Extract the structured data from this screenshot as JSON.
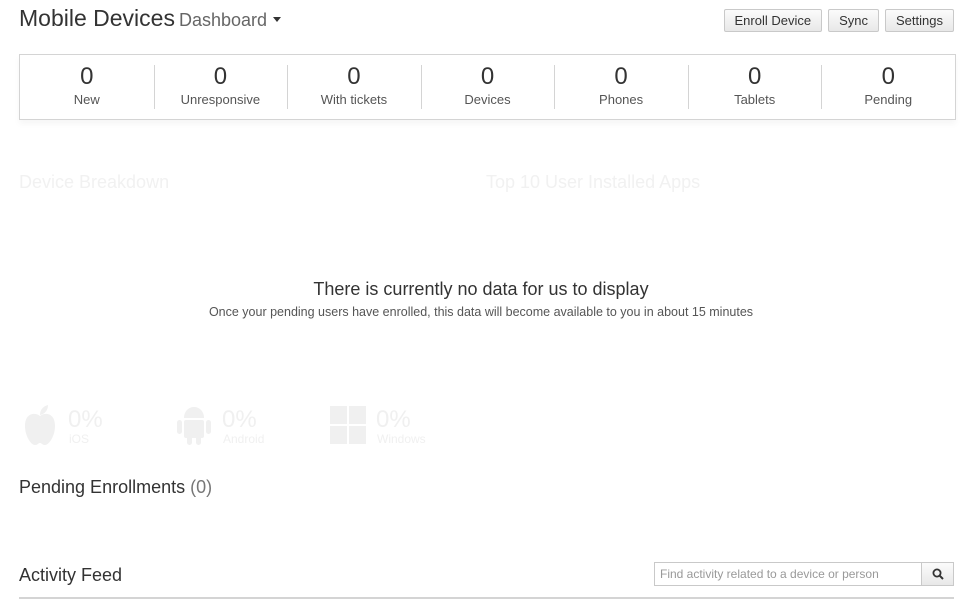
{
  "header": {
    "title": "Mobile Devices",
    "subtitle": "Dashboard",
    "buttons": {
      "enroll": "Enroll Device",
      "sync": "Sync",
      "settings": "Settings"
    }
  },
  "stats": [
    {
      "value": "0",
      "label": "New"
    },
    {
      "value": "0",
      "label": "Unresponsive"
    },
    {
      "value": "0",
      "label": "With tickets"
    },
    {
      "value": "0",
      "label": "Devices"
    },
    {
      "value": "0",
      "label": "Phones"
    },
    {
      "value": "0",
      "label": "Tablets"
    },
    {
      "value": "0",
      "label": "Pending"
    }
  ],
  "panels": {
    "device_breakdown": "Device Breakdown",
    "top_apps": "Top 10 User Installed Apps"
  },
  "empty_state": {
    "title": "There is currently no data for us to display",
    "message": "Once your pending users have enrolled, this data will become available to you in about 15 minutes"
  },
  "os_breakdown": [
    {
      "icon": "apple-icon",
      "percent": "0%",
      "name": "iOS"
    },
    {
      "icon": "android-icon",
      "percent": "0%",
      "name": "Android"
    },
    {
      "icon": "windows-icon",
      "percent": "0%",
      "name": "Windows"
    }
  ],
  "pending": {
    "title": "Pending Enrollments",
    "count": "(0)"
  },
  "activity": {
    "title": "Activity Feed",
    "search_placeholder": "Find activity related to a device or person"
  },
  "colors": {
    "faded": "#f0f0f0",
    "border": "#d4d4d4",
    "text": "#333333"
  }
}
